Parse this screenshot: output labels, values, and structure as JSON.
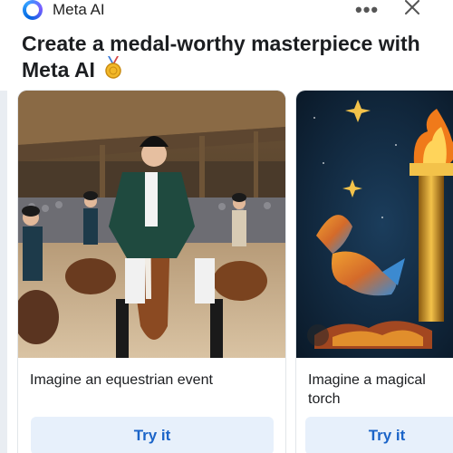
{
  "header": {
    "app_name": "Meta AI",
    "logo_icon": "meta-ai-ring-icon",
    "more_icon": "more-options-icon",
    "close_icon": "close-icon"
  },
  "heading": {
    "text": "Create a medal-worthy masterpiece with Meta AI",
    "emoji_icon": "medal-icon"
  },
  "cards": [
    {
      "image": "equestrian event riders on horses",
      "caption": "Imagine an equestrian event",
      "button": "Try it"
    },
    {
      "image": "magical torch with fish and stars",
      "caption": "Imagine a magical torch",
      "button": "Try it"
    }
  ],
  "colors": {
    "accent": "#1b64c8",
    "button_bg": "#e7f0fb",
    "heading": "#1c1e21"
  }
}
